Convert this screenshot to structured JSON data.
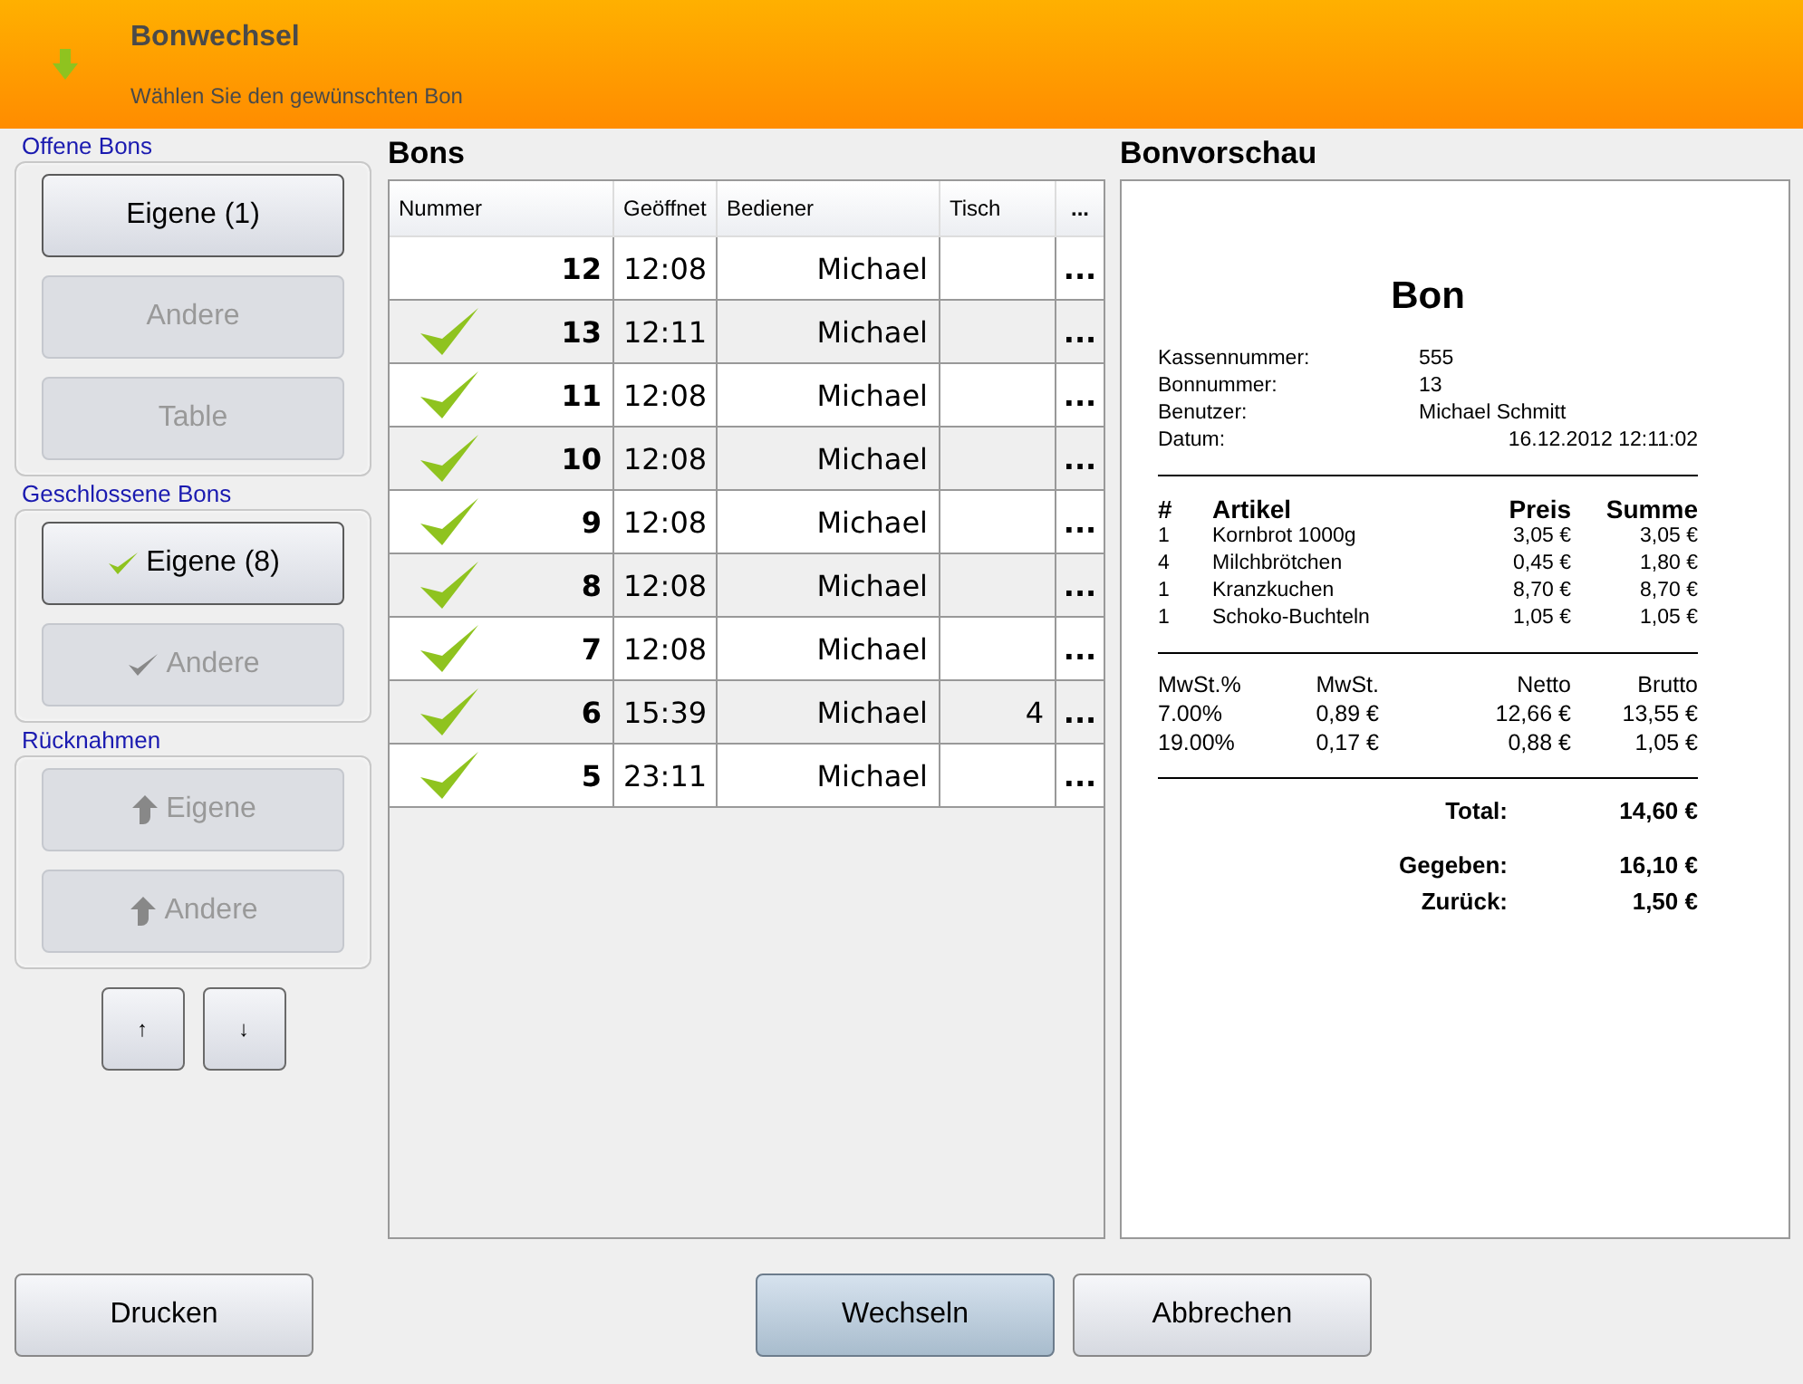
{
  "header": {
    "title": "Bonwechsel",
    "subtitle": "Wählen Sie den gewünschten Bon"
  },
  "groups": [
    {
      "label": "Offene Bons",
      "buttons": [
        {
          "label": "Eigene (1)",
          "kind": "plain",
          "disabled": false
        },
        {
          "label": "Andere",
          "kind": "plain",
          "disabled": true
        },
        {
          "label": "Table",
          "kind": "plain",
          "disabled": true
        }
      ]
    },
    {
      "label": "Geschlossene Bons",
      "buttons": [
        {
          "label": "Eigene (8)",
          "kind": "closed",
          "disabled": false
        },
        {
          "label": "Andere",
          "kind": "closed",
          "disabled": true
        }
      ]
    },
    {
      "label": "Rücknahmen",
      "buttons": [
        {
          "label": "Eigene",
          "kind": "returns",
          "disabled": true
        },
        {
          "label": "Andere",
          "kind": "returns",
          "disabled": true
        }
      ]
    }
  ],
  "scroll_buttons": [
    "↑",
    "↓"
  ],
  "bons": {
    "title": "Bons",
    "columns": [
      "Nummer",
      "Geöffnet",
      "Bediener",
      "Tisch",
      "..."
    ],
    "rows": [
      {
        "closed": false,
        "nummer": "12",
        "time": "12:08",
        "bediener": "Michael",
        "tisch": "",
        "more": "..."
      },
      {
        "closed": true,
        "nummer": "13",
        "time": "12:11",
        "bediener": "Michael",
        "tisch": "",
        "more": "..."
      },
      {
        "closed": true,
        "nummer": "11",
        "time": "12:08",
        "bediener": "Michael",
        "tisch": "",
        "more": "..."
      },
      {
        "closed": true,
        "nummer": "10",
        "time": "12:08",
        "bediener": "Michael",
        "tisch": "",
        "more": "..."
      },
      {
        "closed": true,
        "nummer": "9",
        "time": "12:08",
        "bediener": "Michael",
        "tisch": "",
        "more": "..."
      },
      {
        "closed": true,
        "nummer": "8",
        "time": "12:08",
        "bediener": "Michael",
        "tisch": "",
        "more": "..."
      },
      {
        "closed": true,
        "nummer": "7",
        "time": "12:08",
        "bediener": "Michael",
        "tisch": "",
        "more": "..."
      },
      {
        "closed": true,
        "nummer": "6",
        "time": "15:39",
        "bediener": "Michael",
        "tisch": "4",
        "more": "..."
      },
      {
        "closed": true,
        "nummer": "5",
        "time": "23:11",
        "bediener": "Michael",
        "tisch": "",
        "more": "..."
      }
    ]
  },
  "preview": {
    "title": "Bonvorschau",
    "receipt_title": "Bon",
    "info": [
      {
        "label": "Kassennummer:",
        "value": "555"
      },
      {
        "label": "Bonnummer:",
        "value": "13"
      },
      {
        "label": "Benutzer:",
        "value": "Michael Schmitt"
      },
      {
        "label": "Datum:",
        "value": "16.12.2012  12:11:02"
      }
    ],
    "item_columns": [
      "#",
      "Artikel",
      "Preis",
      "Summe"
    ],
    "items": [
      [
        "1",
        "Kornbrot 1000g",
        "3,05 €",
        "3,05 €"
      ],
      [
        "4",
        "Milchbrötchen",
        "0,45 €",
        "1,80 €"
      ],
      [
        "1",
        "Kranzkuchen",
        "8,70 €",
        "8,70 €"
      ],
      [
        "1",
        "Schoko-Buchteln",
        "1,05 €",
        "1,05 €"
      ]
    ],
    "tax_columns": [
      "MwSt.%",
      "MwSt.",
      "Netto",
      "Brutto"
    ],
    "tax_rows": [
      [
        "7.00%",
        "0,89 €",
        "12,66 €",
        "13,55 €"
      ],
      [
        "19.00%",
        "0,17 €",
        "0,88 €",
        "1,05 €"
      ]
    ],
    "totals": [
      {
        "label": "Total:",
        "value": "14,60 €"
      },
      {
        "label": "Gegeben:",
        "value": "16,10 €"
      },
      {
        "label": "Zurück:",
        "value": "1,50 €"
      }
    ]
  },
  "footer": {
    "print": "Drucken",
    "switch": "Wechseln",
    "cancel": "Abbrechen"
  }
}
